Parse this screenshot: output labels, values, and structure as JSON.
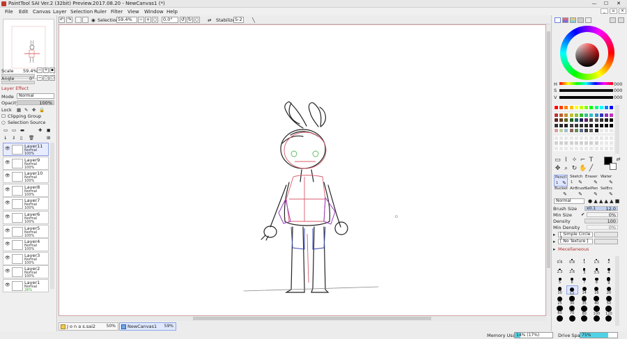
{
  "window": {
    "title": "PaintTool SAI Ver.2 (32bit) Preview.2017.08.20 - NewCanvas1 (*)",
    "minimize": "—",
    "maximize": "☐",
    "close": "✕"
  },
  "menu": [
    "File",
    "Edit",
    "Canvas",
    "Layer",
    "Selection",
    "Ruler",
    "Filter",
    "View",
    "Window",
    "Help"
  ],
  "toolbar": {
    "selection_label": "Selection",
    "zoom": "59.4%",
    "angle": "0.0°",
    "stabilizer_label": "Stabilizer",
    "stabilizer_value": "S-2"
  },
  "navigator": {
    "scale_label": "Scale",
    "scale_value": "59.4%",
    "angle_label": "Angle",
    "angle_value": "0°"
  },
  "layer_effect": {
    "header": "Layer Effect",
    "mode_label": "Mode",
    "mode_value": "Normal",
    "opacity_label": "Opacity",
    "opacity_value": "100%",
    "lock_label": "Lock",
    "clipping_label": "Clipping Group",
    "selection_source_label": "Selection Source"
  },
  "layers": [
    {
      "name": "Layer11",
      "mode": "Normal",
      "opacity": "100%"
    },
    {
      "name": "Layer9",
      "mode": "Normal",
      "opacity": "100%"
    },
    {
      "name": "Layer10",
      "mode": "Normal",
      "opacity": "100%"
    },
    {
      "name": "Layer8",
      "mode": "Normal",
      "opacity": "100%"
    },
    {
      "name": "Layer7",
      "mode": "Normal",
      "opacity": "100%"
    },
    {
      "name": "Layer6",
      "mode": "Normal",
      "opacity": "100%"
    },
    {
      "name": "Layer5",
      "mode": "Normal",
      "opacity": "100%"
    },
    {
      "name": "Layer4",
      "mode": "Normal",
      "opacity": "100%"
    },
    {
      "name": "Layer3",
      "mode": "Normal",
      "opacity": "100%"
    },
    {
      "name": "Layer2",
      "mode": "Normal",
      "opacity": "100%"
    },
    {
      "name": "Layer1",
      "mode": "Normal",
      "opacity": "26%"
    }
  ],
  "tabs": [
    {
      "name": "J o n a s.sai2",
      "zoom": "50%"
    },
    {
      "name": "NewCanvas1",
      "zoom": "59%"
    }
  ],
  "status": {
    "memory_label": "Memory Usage",
    "memory_value": "14% (17%)",
    "memory_fraction": 0.14,
    "drive_label": "Drive Space",
    "drive_value": "75%",
    "drive_fraction": 0.75
  },
  "color": {
    "h_label": "H",
    "s_label": "S",
    "v_label": "V",
    "h_value": "000",
    "s_value": "000",
    "v_value": "000",
    "primary": "#000000",
    "secondary": "#ffffff"
  },
  "brushes": [
    {
      "name": "Pencil",
      "value": "1"
    },
    {
      "name": "Sketch",
      "value": "1"
    },
    {
      "name": "Eraser",
      "value": ""
    },
    {
      "name": "Water",
      "value": ""
    },
    {
      "name": "Bucket",
      "value": ""
    },
    {
      "name": "AirBrush",
      "value": ""
    },
    {
      "name": "SelPen",
      "value": ""
    },
    {
      "name": "SelErs",
      "value": ""
    }
  ],
  "brush_props": {
    "blend_mode": "Normal",
    "size_label": "Brush Size",
    "size_mult": "x0.1",
    "size_value": "12.0",
    "min_size_label": "Min Size",
    "min_size_value": "0%",
    "density_label": "Density",
    "density_value": "100",
    "min_density_label": "Min Density",
    "min_density_value": "0%",
    "shape": "[ Simple Circle ]",
    "texture": "[ No Texture ]",
    "misc": "Mecellaneous"
  },
  "brush_tips": [
    "0.6",
    "0.8",
    "1",
    "1.5",
    "2",
    "2.3",
    "2.6",
    "3",
    "3.5",
    "4",
    "5",
    "6",
    "7",
    "8",
    "9",
    "10",
    "12",
    "14",
    "16",
    "20",
    "25",
    "30",
    "35",
    "40",
    "50",
    "60",
    "70",
    "80",
    "100",
    "120",
    "",
    "",
    "",
    "",
    ""
  ],
  "accent": "#8ea4e6"
}
